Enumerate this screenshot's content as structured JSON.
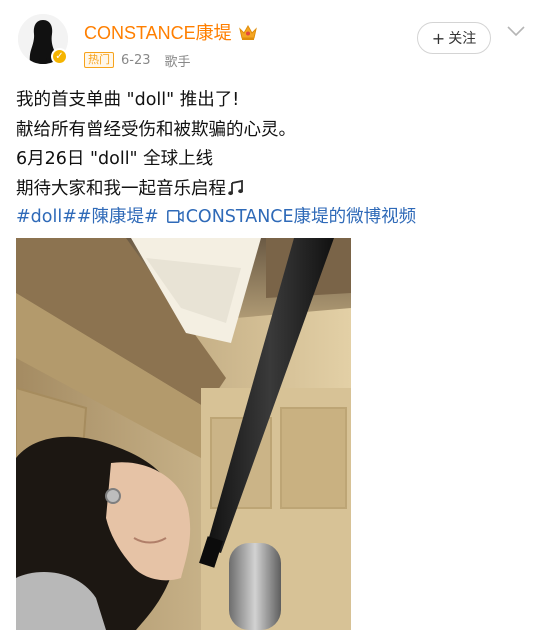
{
  "user": {
    "name": "CONSTANCE康堤",
    "crown_icon": "crown-icon",
    "verified_icon": "verified-badge-icon",
    "accent_color": "#ff7f00"
  },
  "meta": {
    "hot_tag": "热门",
    "date": "6-23",
    "category": "歌手"
  },
  "follow_button": {
    "plus": "+",
    "label": "关注"
  },
  "post": {
    "lines": [
      "我的首支单曲  \"doll\" 推出了!",
      "献给所有曾经受伤和被欺骗的心灵。",
      "6月26日 \"doll\" 全球上线",
      "期待大家和我一起音乐启程"
    ],
    "music_icon": "music-note-icon"
  },
  "tags": {
    "tag1": "#doll#",
    "tag2": "#陳康堤#",
    "video_link": "CONSTANCE康堤的微博视频",
    "link_color": "#2f6ab8"
  },
  "video": {
    "icon": "video-icon"
  }
}
